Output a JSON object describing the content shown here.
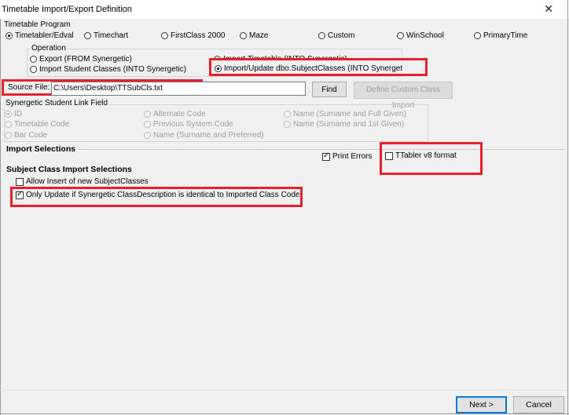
{
  "window": {
    "title": "Timetable Import/Export Definition",
    "close_glyph": "✕"
  },
  "timetable_program": {
    "label": "Timetable Program",
    "options": [
      {
        "label": "Timetabler/Edval",
        "selected": true
      },
      {
        "label": "Timechart",
        "selected": false
      },
      {
        "label": "FirstClass 2000",
        "selected": false
      },
      {
        "label": "Maze",
        "selected": false
      },
      {
        "label": "Custom",
        "selected": false
      },
      {
        "label": "WinSchool",
        "selected": false
      },
      {
        "label": "PrimaryTime",
        "selected": false
      }
    ]
  },
  "operation": {
    "label": "Operation",
    "options": [
      {
        "label": "Export (FROM Synergetic)",
        "selected": false
      },
      {
        "label": "Import Timetable (INTO Synergetic)",
        "selected": false
      },
      {
        "label": "Import Student Classes (INTO Synergetic)",
        "selected": false
      },
      {
        "label": "Import/Update dbo.SubjectClasses (INTO Synerget",
        "selected": true
      }
    ]
  },
  "source_file": {
    "label": "Source File:",
    "value": "C:\\Users\\Desktop\\TTSubCls.txt",
    "find_label": "Find",
    "custom_import_label": "Define Custom Class Import"
  },
  "student_link": {
    "label": "Synergetic Student Link Field",
    "col1": [
      {
        "label": "ID",
        "selected": true
      },
      {
        "label": "Timetable Code",
        "selected": false
      },
      {
        "label": "Bar Code",
        "selected": false
      }
    ],
    "col2": [
      {
        "label": "Alternate Code",
        "selected": false
      },
      {
        "label": "Previous System Code",
        "selected": false
      },
      {
        "label": "Name (Surname and Preferred)",
        "selected": false
      }
    ],
    "col3": [
      {
        "label": "Name (Surname and Full Given)",
        "selected": false
      },
      {
        "label": "Name (Surname and 1st Given)",
        "selected": false
      }
    ]
  },
  "import_selections": {
    "label": "Import Selections",
    "print_errors": {
      "label": "Print Errors",
      "checked": true
    },
    "ttabler_v8": {
      "label": "TTabler v8 format",
      "checked": false
    }
  },
  "subject_class": {
    "label": "Subject Class Import Selections",
    "allow_insert": {
      "label": "Allow Insert of new SubjectClasses",
      "checked": false
    },
    "only_update": {
      "label": "Only Update if Synergetic ClassDescription is identical to Imported Class Code",
      "checked": true
    }
  },
  "footer": {
    "next_label": "Next >",
    "cancel_label": "Cancel"
  },
  "colors": {
    "highlight": "#e8202e",
    "default_button": "#0078d7",
    "background": "#f0f0f0"
  }
}
